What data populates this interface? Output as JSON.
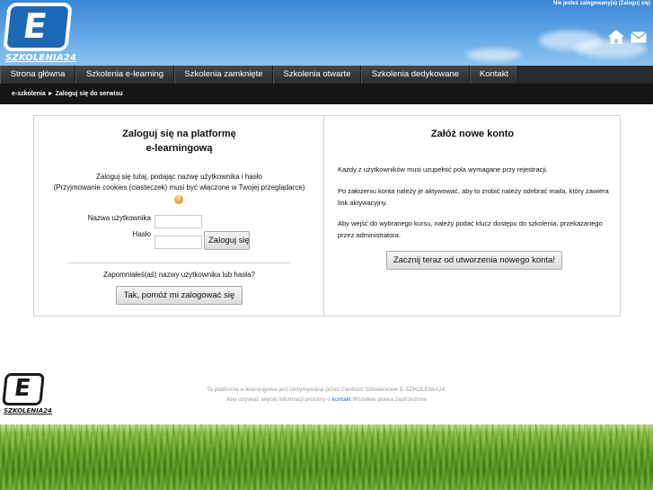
{
  "header": {
    "logo_text": "SZKOLENIA24",
    "logo_letter": "E",
    "login_status": "Nie jesteś zalogowany(a) (Zaloguj się)"
  },
  "nav": {
    "items": [
      {
        "label": "Strona główna"
      },
      {
        "label": "Szkolenia e-learning"
      },
      {
        "label": "Szkolenia zamknięte"
      },
      {
        "label": "Szkolenia otwarte"
      },
      {
        "label": "Szkolenia dedykowane"
      },
      {
        "label": "Kontakt"
      }
    ]
  },
  "breadcrumb": {
    "home": "e-szkolenia",
    "separator": "►",
    "current": "Zaloguj się do serwisu"
  },
  "login": {
    "title_line1": "Zaloguj się na platformę",
    "title_line2": "e-learningową",
    "intro_line1": "Zaloguj się tutaj, podając nazwę użytkownika i hasło",
    "intro_line2": "(Przyjmowanie cookies (ciasteczek) musi być włączone w Twojej przeglądarce)",
    "username_label": "Nazwa użytkownika",
    "password_label": "Hasło",
    "username_value": "",
    "password_value": "",
    "login_button": "Zaloguj się",
    "forgot_text": "Zapomniałeś(aś) nazwy użytkownika lub hasła?",
    "forgot_button": "Tak, pomóż mi zalogować się"
  },
  "signup": {
    "title": "Załóż nowe konto",
    "p1": "Każdy z użytkowników musi uzupełnić pola wymagane przy rejestracji.",
    "p2": "Po założeniu konta należy je aktywować, aby to zrobić należy odebrać maila, który zawiera link aktywacyjny.",
    "p3": "Aby wejść do wybranego kursu, należy podać klucz dostępu do szkolenia, przekazanego przez administratora.",
    "button": "Zacznij teraz od utworzenia nowego konta!"
  },
  "footer": {
    "line1": "Ta platforma e-learningowa jest utrzymywana przez Centrum Szkoleniowe E-SZKOLENIA24.",
    "line2_before": "Aby uzyskać więcej informacji prosimy o",
    "contact_link": "kontakt",
    "line2_after": "Wszelkie prawa zastrzeżone",
    "logo_text": "SZKOLENIA24",
    "logo_letter": "E"
  },
  "icons": {
    "home": "home-icon",
    "mail": "mail-icon",
    "help": "help-icon"
  },
  "colors": {
    "header_sky": "#4a95dc",
    "nav_bg": "#2a2a2a",
    "breadcrumb_bg": "#151515",
    "link": "#2b6cc4"
  }
}
